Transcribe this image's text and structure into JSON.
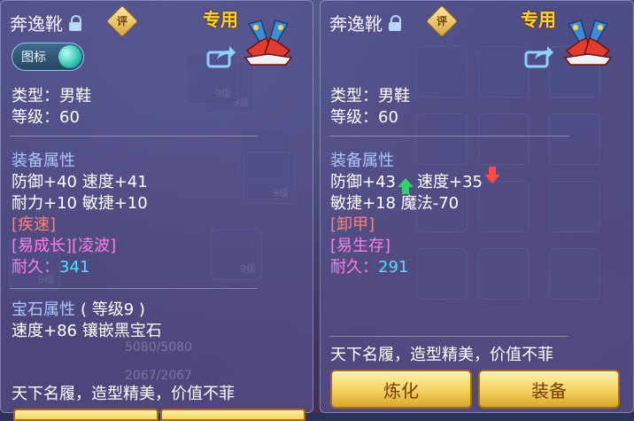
{
  "background": {
    "slot_levels": [
      "9级",
      "9级",
      "9级",
      "9级",
      "9级"
    ],
    "bar_text": "5080/5080",
    "bar_text2": "2067/2067"
  },
  "left_panel": {
    "title": "奔逸靴",
    "rate_label": "评",
    "dedicated": "专用",
    "toggle_label": "图标",
    "type_line": "类型：男鞋",
    "level_line": "等级：60",
    "equip_attr_header": "装备属性",
    "attr_line_1": "防御+40 速度+41",
    "attr_line_2": "耐力+10 敏捷+10",
    "special_skill": "[疾速]",
    "special_effects": "[易成长][凌波]",
    "durability_label": "耐久：",
    "durability_value": "341",
    "gem_attr_header": "宝石属性",
    "gem_level": "( 等级9 )",
    "gem_line": "速度+86 镶嵌黑宝石",
    "description": "天下名履，造型精美，价值不菲"
  },
  "right_panel": {
    "title": "奔逸靴",
    "rate_label": "评",
    "dedicated": "专用",
    "type_line": "类型：男鞋",
    "level_line": "等级：60",
    "equip_attr_header": "装备属性",
    "defense": "防御+43",
    "speed": "速度+35",
    "attr_line_2": "敏捷+18 魔法-70",
    "special_skill": "[卸甲]",
    "special_effects": "[易生存]",
    "durability_label": "耐久：",
    "durability_value": "291",
    "description": "天下名履，造型精美，价值不菲",
    "refine_button": "炼化",
    "equip_button": "装备"
  },
  "icons": [
    "lock-icon",
    "rate-icon",
    "boots-icon",
    "share-icon",
    "arrow-up-icon",
    "arrow-down-icon"
  ],
  "colors": {
    "panel": "#58508c",
    "header_blue": "#a9c8ff",
    "special_red": "#ff8080",
    "effect_pink": "#ff7de4",
    "durability_cyan": "#4fe0ff",
    "dedicated_gold": "#ffcf3a",
    "button_gold": "#f4d25e",
    "up_green": "#2fd36a",
    "down_red": "#ff4a4a"
  }
}
